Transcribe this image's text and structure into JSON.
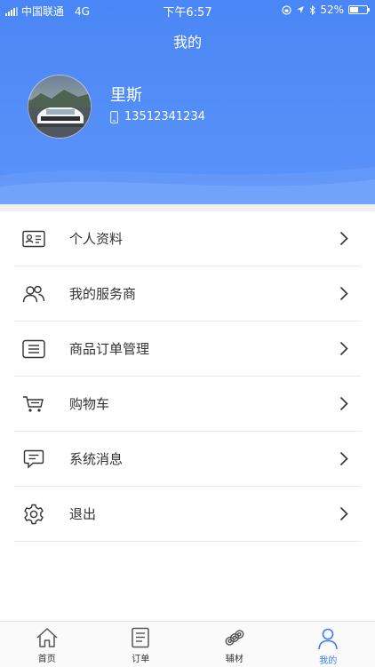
{
  "status": {
    "carrier": "中国联通",
    "network": "4G",
    "time": "下午6:57",
    "battery": "52%",
    "battery_level": 0.52
  },
  "header": {
    "title": "我的",
    "username": "里斯",
    "phone": "13512341234"
  },
  "colors": {
    "primary": "#4a86f6",
    "tab_active": "#3b7cf2"
  },
  "menu": [
    {
      "label": "个人资料",
      "icon": "id-card-icon"
    },
    {
      "label": "我的服务商",
      "icon": "users-icon"
    },
    {
      "label": "商品订单管理",
      "icon": "list-icon"
    },
    {
      "label": "购物车",
      "icon": "cart-icon"
    },
    {
      "label": "系统消息",
      "icon": "message-icon"
    },
    {
      "label": "退出",
      "icon": "gear-icon"
    }
  ],
  "tabs": [
    {
      "label": "首页",
      "icon": "home-icon"
    },
    {
      "label": "订单",
      "icon": "order-icon"
    },
    {
      "label": "辅材",
      "icon": "materials-icon"
    },
    {
      "label": "我的",
      "icon": "profile-icon",
      "active": true
    }
  ]
}
